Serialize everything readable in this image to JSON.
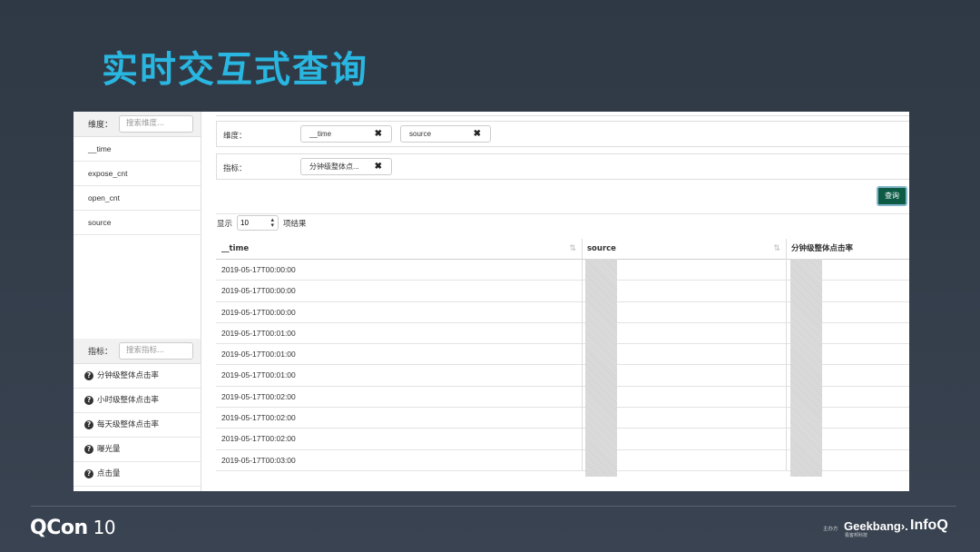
{
  "slide": {
    "title": "实时交互式查询"
  },
  "sidebar": {
    "dimension_label": "维度：",
    "dimension_placeholder": "搜索维度...",
    "dimensions": [
      "__time",
      "expose_cnt",
      "open_cnt",
      "source"
    ],
    "metric_label": "指标：",
    "metric_placeholder": "搜索指标...",
    "metrics": [
      "分钟级整体点击率",
      "小时级整体点击率",
      "每天级整体点击率",
      "曝光量",
      "点击量"
    ]
  },
  "filters": {
    "dimension_label": "维度：",
    "dimension_chips": [
      "__time",
      "source"
    ],
    "metric_label": "指标：",
    "metric_chips": [
      "分钟级整体点..."
    ]
  },
  "query_button": "查询",
  "pager": {
    "show": "显示",
    "page_size": "10",
    "suffix": "项结果"
  },
  "table": {
    "columns": [
      "__time",
      "source",
      "分钟级整体点击率"
    ],
    "rows": [
      "2019-05-17T00:00:00",
      "2019-05-17T00:00:00",
      "2019-05-17T00:00:00",
      "2019-05-17T00:01:00",
      "2019-05-17T00:01:00",
      "2019-05-17T00:01:00",
      "2019-05-17T00:02:00",
      "2019-05-17T00:02:00",
      "2019-05-17T00:02:00",
      "2019-05-17T00:03:00"
    ]
  },
  "footer": {
    "qcon": "QCon",
    "qcon_edition": "10",
    "host": "主办方",
    "geekbang": "Geekbang›.",
    "geekbang_sub": "极客邦科技",
    "infoq": "InfoQ"
  }
}
